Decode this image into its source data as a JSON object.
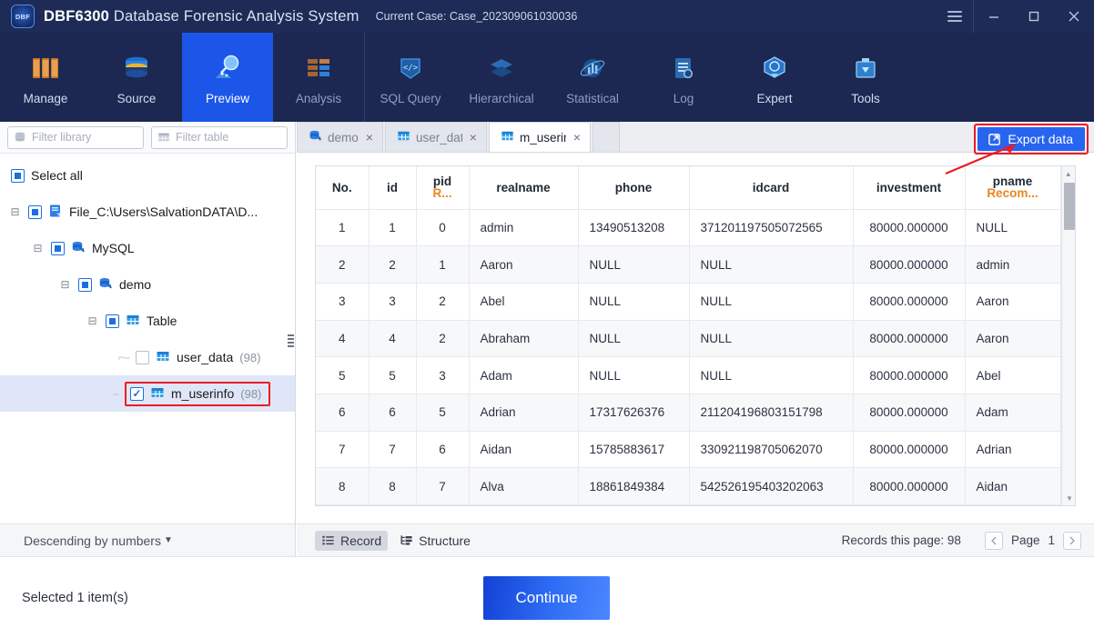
{
  "titlebar": {
    "logo_text": "DBF",
    "brand": "DBF6300",
    "subtitle": "Database Forensic Analysis System",
    "case_label": "Current Case: Case_202309061030036",
    "menu_icon": "hamburger-icon",
    "minimize_icon": "minimize-icon",
    "maximize_icon": "maximize-icon",
    "close_icon": "close-icon"
  },
  "nav": {
    "items": [
      {
        "label": "Manage",
        "state": "enabled"
      },
      {
        "label": "Source",
        "state": "enabled"
      },
      {
        "label": "Preview",
        "state": "active"
      },
      {
        "label": "Analysis",
        "state": "disabled"
      },
      {
        "label": "SQL Query",
        "state": "disabled"
      },
      {
        "label": "Hierarchical",
        "state": "disabled"
      },
      {
        "label": "Statistical",
        "state": "disabled"
      },
      {
        "label": "Log",
        "state": "disabled"
      },
      {
        "label": "Expert",
        "state": "enabled"
      },
      {
        "label": "Tools",
        "state": "enabled"
      }
    ]
  },
  "sidebar": {
    "filter_library_placeholder": "Filter library",
    "filter_table_placeholder": "Filter table",
    "select_all_label": "Select all",
    "tree": [
      {
        "label": "File_C:\\Users\\SalvationDATA\\D...",
        "count": "",
        "icon": "file-icon",
        "check": "partial",
        "depth": 0
      },
      {
        "label": "MySQL",
        "count": "",
        "icon": "database-icon",
        "check": "partial",
        "depth": 1
      },
      {
        "label": "demo",
        "count": "",
        "icon": "database-icon",
        "check": "partial",
        "depth": 2
      },
      {
        "label": "Table",
        "count": "",
        "icon": "table-icon",
        "check": "partial",
        "depth": 3
      },
      {
        "label": "user_data",
        "count": "(98)",
        "icon": "table-icon",
        "check": "empty",
        "depth": 4
      },
      {
        "label": "m_userinfo",
        "count": "(98)",
        "icon": "table-icon",
        "check": "checked",
        "depth": 4
      }
    ],
    "sort_label": "Descending by numbers",
    "sort_caret": "▼"
  },
  "tabs": {
    "items": [
      {
        "label": "demo",
        "icon": "database-icon",
        "active": false,
        "close": "×"
      },
      {
        "label": "user_data",
        "icon": "table-icon",
        "active": false,
        "close": "×"
      },
      {
        "label": "m_userinfo",
        "icon": "table-icon",
        "active": true,
        "close": "×"
      }
    ],
    "export_label": "Export data",
    "export_icon": "export-icon"
  },
  "grid": {
    "columns": [
      {
        "key": "no",
        "label": "No.",
        "sub": ""
      },
      {
        "key": "id",
        "label": "id",
        "sub": ""
      },
      {
        "key": "pid",
        "label": "pid",
        "sub": "R..."
      },
      {
        "key": "realname",
        "label": "realname",
        "sub": ""
      },
      {
        "key": "phone",
        "label": "phone",
        "sub": ""
      },
      {
        "key": "idcard",
        "label": "idcard",
        "sub": ""
      },
      {
        "key": "investment",
        "label": "investment",
        "sub": ""
      },
      {
        "key": "pname",
        "label": "pname",
        "sub": "Recom..."
      }
    ],
    "rows": [
      {
        "no": "1",
        "id": "1",
        "pid": "0",
        "realname": "admin",
        "phone": "13490513208",
        "idcard": "371201197505072565",
        "investment": "80000.000000",
        "pname": "NULL"
      },
      {
        "no": "2",
        "id": "2",
        "pid": "1",
        "realname": "Aaron",
        "phone": "NULL",
        "idcard": "NULL",
        "investment": "80000.000000",
        "pname": "admin"
      },
      {
        "no": "3",
        "id": "3",
        "pid": "2",
        "realname": "Abel",
        "phone": "NULL",
        "idcard": "NULL",
        "investment": "80000.000000",
        "pname": "Aaron"
      },
      {
        "no": "4",
        "id": "4",
        "pid": "2",
        "realname": "Abraham",
        "phone": "NULL",
        "idcard": "NULL",
        "investment": "80000.000000",
        "pname": "Aaron"
      },
      {
        "no": "5",
        "id": "5",
        "pid": "3",
        "realname": "Adam",
        "phone": "NULL",
        "idcard": "NULL",
        "investment": "80000.000000",
        "pname": "Abel"
      },
      {
        "no": "6",
        "id": "6",
        "pid": "5",
        "realname": "Adrian",
        "phone": "17317626376",
        "idcard": "211204196803151798",
        "investment": "80000.000000",
        "pname": "Adam"
      },
      {
        "no": "7",
        "id": "7",
        "pid": "6",
        "realname": "Aidan",
        "phone": "15785883617",
        "idcard": "330921198705062070",
        "investment": "80000.000000",
        "pname": "Adrian"
      },
      {
        "no": "8",
        "id": "8",
        "pid": "7",
        "realname": "Alva",
        "phone": "18861849384",
        "idcard": "542526195403202063",
        "investment": "80000.000000",
        "pname": "Aidan"
      }
    ]
  },
  "status": {
    "record_label": "Record",
    "record_icon": "list-icon",
    "structure_label": "Structure",
    "structure_icon": "tree-icon",
    "records_this_page": "Records this page:  98",
    "page_word": "Page",
    "page_number": "1",
    "prev_icon": "chevron-left-icon",
    "next_icon": "chevron-right-icon"
  },
  "footer": {
    "selected_text": "Selected 1 item(s)",
    "continue_label": "Continue"
  },
  "colors": {
    "titlebar_bg": "#1e2b57",
    "ribbon_bg": "#1c2852",
    "accent_blue": "#1b56e8",
    "export_blue": "#2764f0",
    "highlight_red": "#ec1c24",
    "id_value": "#b58a4a",
    "investment_value": "#179e92",
    "subheader_orange": "#e8871e"
  }
}
